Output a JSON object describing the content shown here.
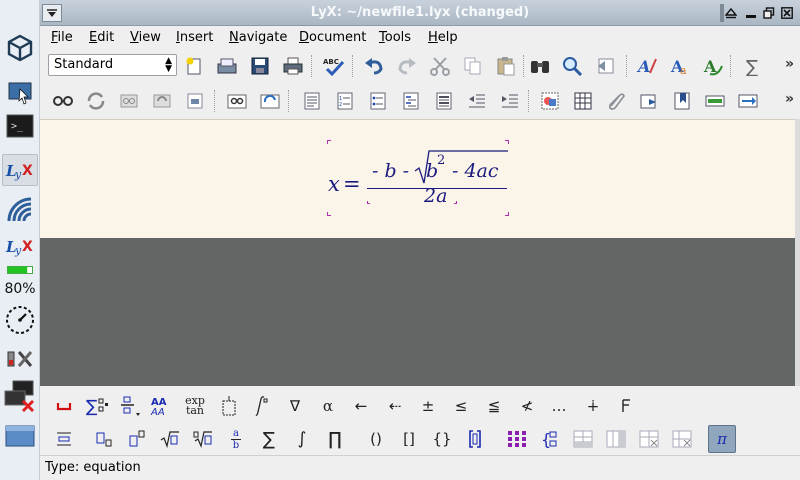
{
  "window": {
    "title": "LyX: ~/newfile1.lyx (changed)"
  },
  "menubar": {
    "items": [
      {
        "label": "File",
        "mnemonic": "F",
        "rest": "ile"
      },
      {
        "label": "Edit",
        "mnemonic": "E",
        "rest": "dit"
      },
      {
        "label": "View",
        "mnemonic": "V",
        "rest": "iew"
      },
      {
        "label": "Insert",
        "mnemonic": "I",
        "rest": "nsert"
      },
      {
        "label": "Navigate",
        "mnemonic": "N",
        "rest": "avigate"
      },
      {
        "label": "Document",
        "mnemonic": "D",
        "rest": "ocument"
      },
      {
        "label": "Tools",
        "mnemonic": "T",
        "rest": "ools"
      },
      {
        "label": "Help",
        "mnemonic": "H",
        "rest": "elp"
      }
    ]
  },
  "toolbar": {
    "layout_value": "Standard",
    "overflow": "»"
  },
  "dock": {
    "battery_percent": "80%",
    "battery_level": 0.8
  },
  "document": {
    "equation": {
      "lhs": "x",
      "equals": "=",
      "numerator_prefix": "- b -",
      "radicand_base": "b",
      "radicand_exp": "2",
      "radicand_rest": "- 4ac",
      "denominator": "2a"
    }
  },
  "math_toolbar": {
    "exp_label": "exp",
    "tan_label": "tan",
    "fraction_a": "a",
    "fraction_b": "b",
    "sum": "∑",
    "integral": "∫",
    "product": "∏",
    "parens": "()",
    "brackets": "[]",
    "braces": "{}",
    "nabla": "∇",
    "alpha": "α",
    "left_arrow": "←",
    "dotted_left_arrow": "⇠",
    "plus_minus": "±",
    "leq": "≤",
    "leqq": "≦",
    "not_less": "≮",
    "ellipsis": "…",
    "dot_plus": "∔",
    "pi": "π"
  },
  "status": {
    "text": "Type: equation"
  },
  "colors": {
    "doc_background": "#fbf4e8",
    "empty_background": "#626665",
    "math_text": "#1a1a80",
    "math_frame": "#b030b0"
  }
}
